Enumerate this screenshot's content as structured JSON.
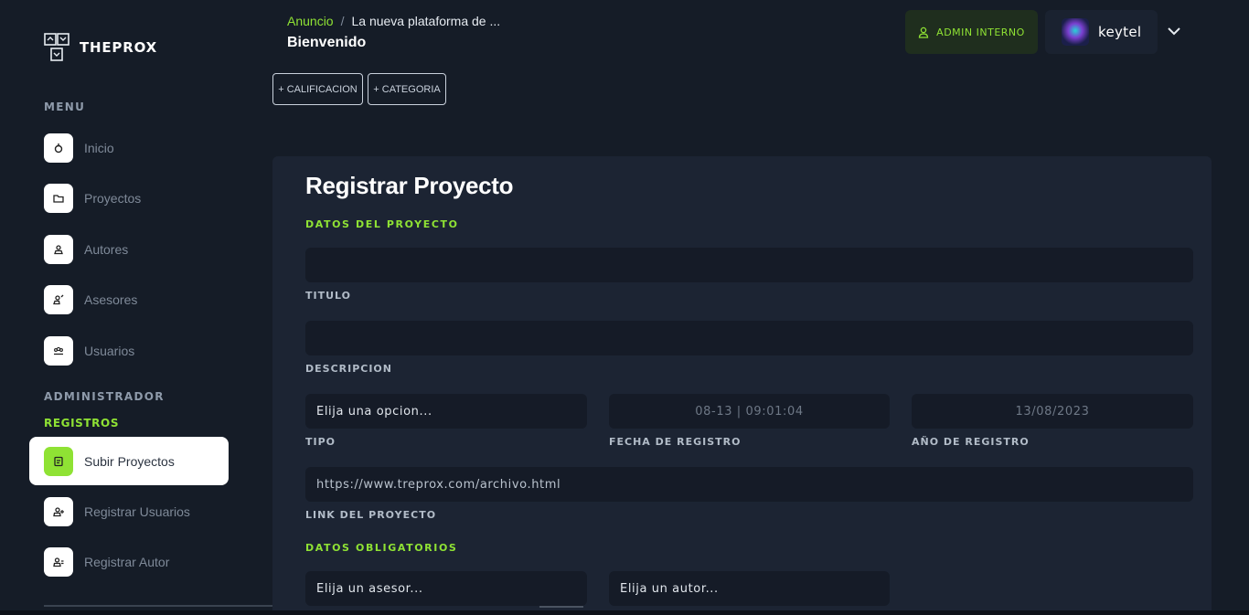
{
  "app": {
    "name": "THEPROX"
  },
  "sidebar": {
    "menu_title": "MENU",
    "menu_items": [
      {
        "label": "Inicio",
        "icon": "home-icon"
      },
      {
        "label": "Proyectos",
        "icon": "folder-icon"
      },
      {
        "label": "Autores",
        "icon": "user-icon"
      },
      {
        "label": "Asesores",
        "icon": "user-edit-icon"
      },
      {
        "label": "Usuarios",
        "icon": "users-icon"
      }
    ],
    "admin_title": "ADMINISTRADOR",
    "admin_subtitle": "REGISTROS",
    "admin_items": [
      {
        "label": "Subir Proyectos",
        "icon": "upload-file-icon",
        "active": true
      },
      {
        "label": "Registrar Usuarios",
        "icon": "user-plus-icon"
      },
      {
        "label": "Registrar Autor",
        "icon": "user-add-icon"
      }
    ]
  },
  "header": {
    "breadcrumb_link": "Anuncio",
    "breadcrumb_separator": "/",
    "breadcrumb_current": "La nueva plataforma de ...",
    "page_title": "Bienvenido",
    "buttons": {
      "calificacion": "+ CALIFICACION",
      "categoria": "+ CATEGORIA"
    },
    "role_badge": "ADMIN INTERNO",
    "user_name": "keytel"
  },
  "form": {
    "title": "Registrar Proyecto",
    "section_project": "DATOS DEL PROYECTO",
    "titulo": {
      "value": "",
      "caption": "TITULO"
    },
    "descripcion": {
      "value": "",
      "caption": "DESCRIPCION"
    },
    "tipo": {
      "value": "Elija una opcion...",
      "caption": "TIPO"
    },
    "fecha_registro": {
      "value": "08-13 | 09:01:04",
      "caption": "FECHA DE REGISTRO"
    },
    "anio_registro": {
      "value": "13/08/2023",
      "caption": "AÑO DE REGISTRO"
    },
    "link": {
      "value": "https://www.treprox.com/archivo.html",
      "caption": "LINK DEL PROYECTO"
    },
    "section_required": "DATOS OBLIGATORIOS",
    "asesor": {
      "value": "Elija un asesor..."
    },
    "autor": {
      "value": "Elija un autor..."
    }
  },
  "colors": {
    "accent": "#8fe234",
    "background": "#151c27",
    "card": "#1c2433",
    "field": "#151b27"
  }
}
